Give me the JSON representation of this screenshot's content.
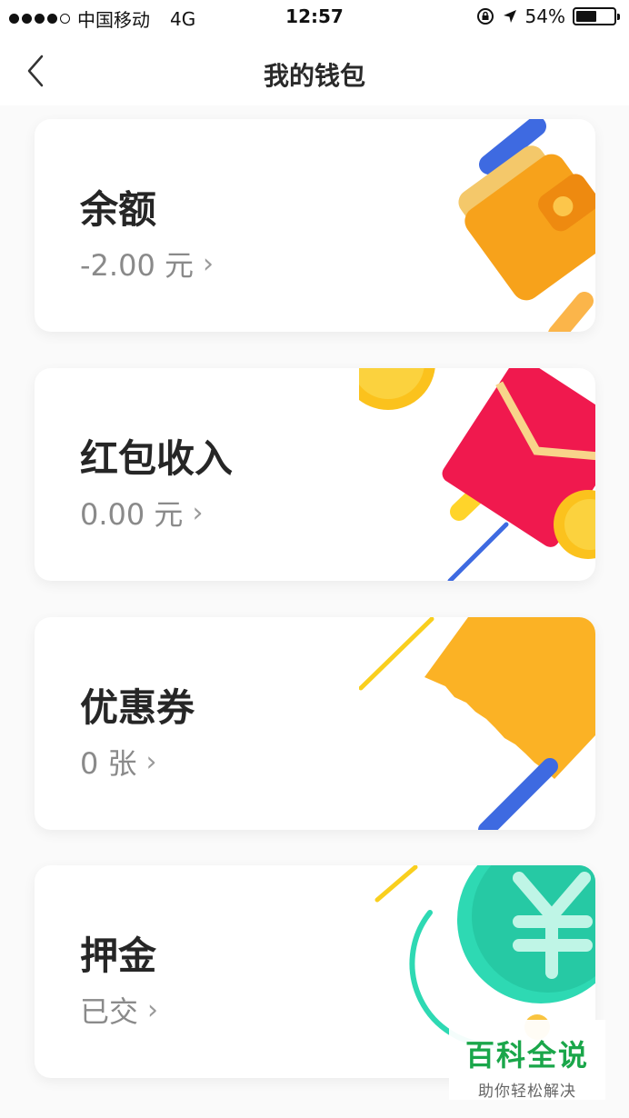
{
  "status_bar": {
    "carrier": "中国移动",
    "network": "4G",
    "time": "12:57",
    "battery_percent_label": "54%",
    "battery_level": 0.54,
    "signal_bars_filled": 4,
    "signal_bars_total": 5
  },
  "nav": {
    "title": "我的钱包",
    "back_icon": "chevron-left-icon"
  },
  "cards": [
    {
      "title": "余额",
      "value": "-2.00 元",
      "chevron": "›",
      "icon": "wallet-icon",
      "accent": "#F7A21B"
    },
    {
      "title": "红包收入",
      "value": "0.00 元",
      "chevron": "›",
      "icon": "red-envelope-icon",
      "accent": "#F0194E"
    },
    {
      "title": "优惠券",
      "value": "0 张",
      "chevron": "›",
      "icon": "coupon-icon",
      "accent": "#FBB225"
    },
    {
      "title": "押金",
      "value": "已交",
      "chevron": "›",
      "icon": "yuan-coin-icon",
      "accent": "#2ED9B3"
    }
  ],
  "watermark": {
    "main": "百科全说",
    "sub": "助你轻松解决"
  }
}
